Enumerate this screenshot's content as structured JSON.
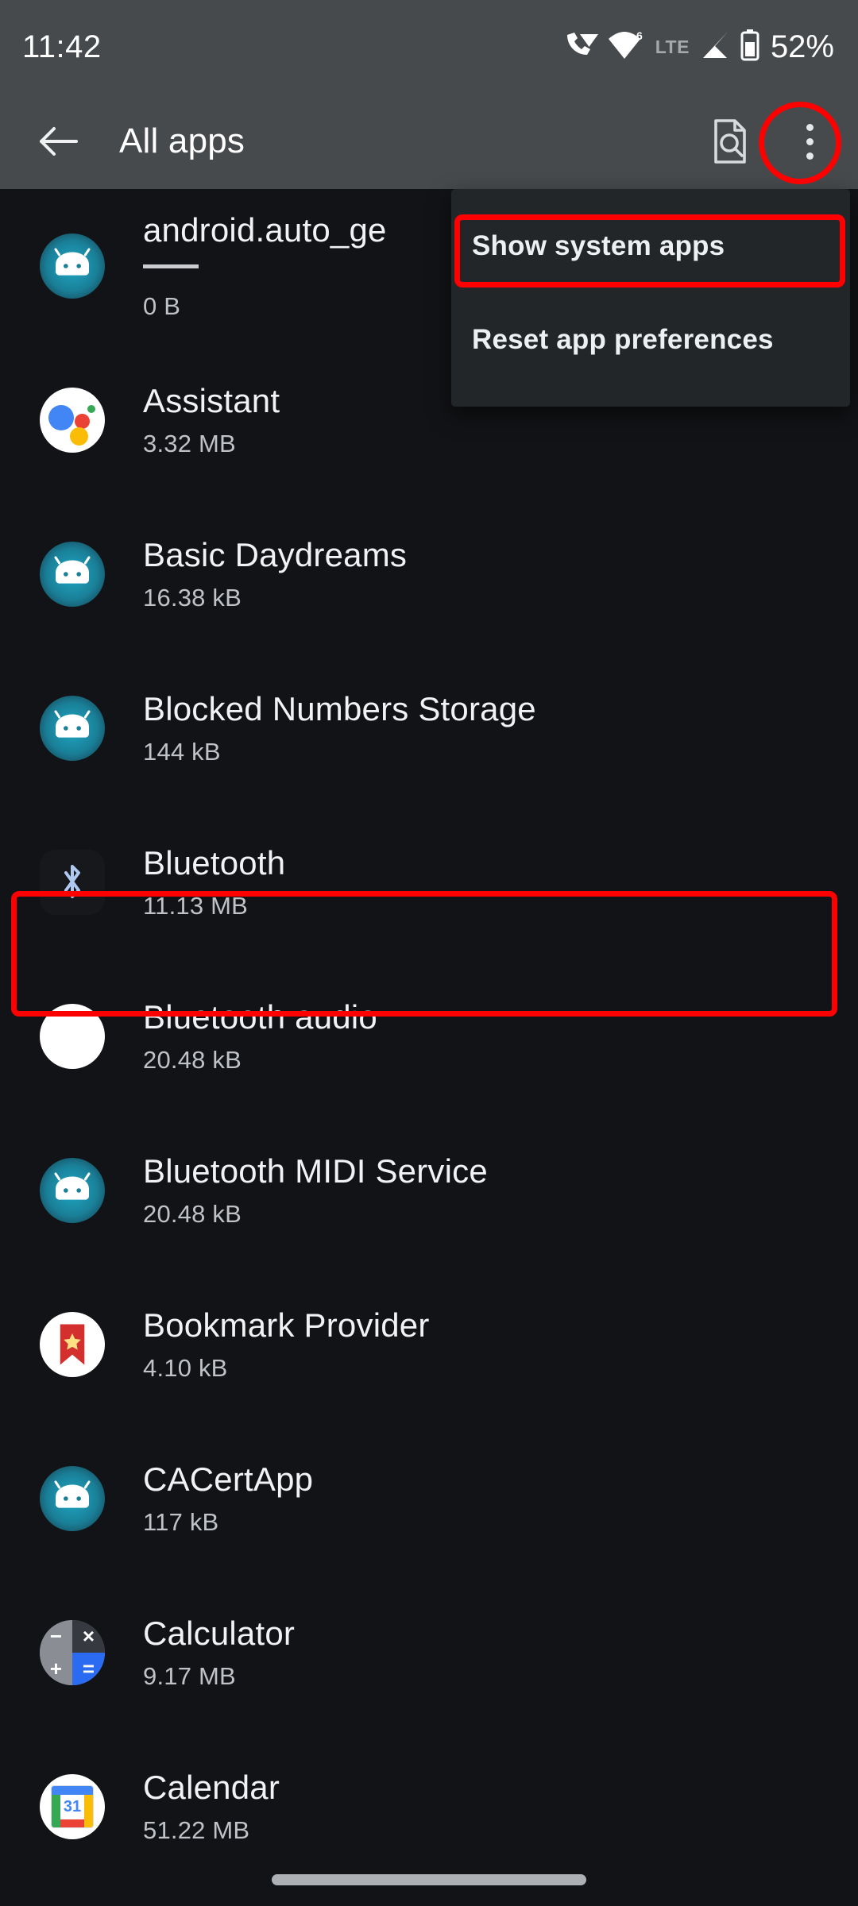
{
  "status_bar": {
    "clock": "11:42",
    "network_label": "LTE",
    "battery_percent": "52%",
    "icons": [
      "call-wifi-icon",
      "wifi-6-icon",
      "lte-label",
      "cellular-signal-icon",
      "battery-icon"
    ],
    "wifi_generation": "6",
    "background": "#474A4D"
  },
  "app_bar": {
    "back_label": "back-arrow",
    "title": "All apps",
    "search_action": "search-document-icon",
    "overflow_action": "more-options-icon",
    "background": "#474A4D"
  },
  "overflow_menu": {
    "visible": true,
    "items": [
      {
        "label": "Show system apps",
        "highlighted": true
      },
      {
        "label": "Reset app preferences",
        "highlighted": false
      }
    ],
    "background": "#222629"
  },
  "annotations": {
    "highlight_color": "#FF0000",
    "targets": [
      "more-options-icon",
      "Show system apps",
      "Bluetooth"
    ]
  },
  "app_list": [
    {
      "name": "android.auto_ge",
      "size": "0 B",
      "icon": "android-robot-icon",
      "truncated": true,
      "has_dash": true
    },
    {
      "name": "Assistant",
      "size": "3.32 MB",
      "icon": "google-assistant-icon"
    },
    {
      "name": "Basic Daydreams",
      "size": "16.38 kB",
      "icon": "android-robot-icon"
    },
    {
      "name": "Blocked Numbers Storage",
      "size": "144 kB",
      "icon": "android-robot-icon"
    },
    {
      "name": "Bluetooth",
      "size": "11.13 MB",
      "icon": "bluetooth-icon",
      "highlighted": true
    },
    {
      "name": "Bluetooth audio",
      "size": "20.48 kB",
      "icon": "white-circle-icon"
    },
    {
      "name": "Bluetooth MIDI Service",
      "size": "20.48 kB",
      "icon": "android-robot-icon"
    },
    {
      "name": "Bookmark Provider",
      "size": "4.10 kB",
      "icon": "bookmark-icon"
    },
    {
      "name": "CACertApp",
      "size": "117 kB",
      "icon": "android-robot-icon"
    },
    {
      "name": "Calculator",
      "size": "9.17 MB",
      "icon": "calculator-icon"
    },
    {
      "name": "Calendar",
      "size": "51.22 MB",
      "icon": "calendar-icon"
    }
  ],
  "calculator_icon_glyphs": {
    "q1": "−",
    "q2": "×",
    "q3": "+",
    "q4": "="
  },
  "calendar_icon_day": "31",
  "navigation": {
    "gesture_handle": "home-gesture-handle"
  },
  "theme": {
    "background": "#121316",
    "text_primary": "#F1F2F3",
    "text_secondary": "#BFC2C6"
  }
}
